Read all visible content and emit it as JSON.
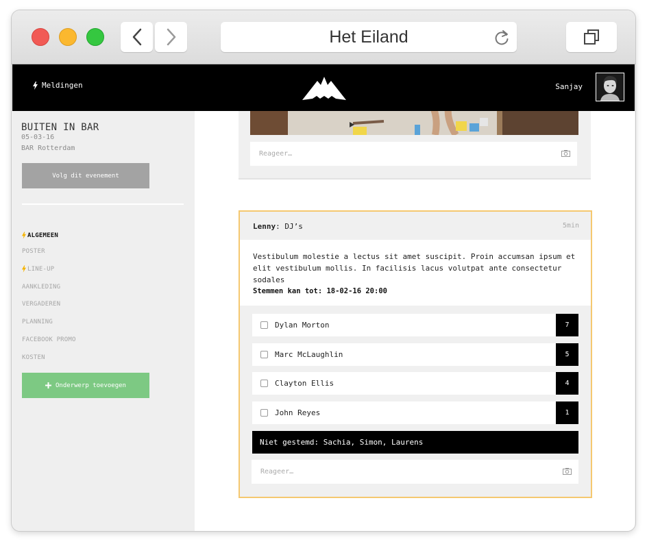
{
  "browser": {
    "title": "Het Eiland"
  },
  "topbar": {
    "notifications_label": "Meldingen",
    "username": "Sanjay"
  },
  "sidebar": {
    "event_title": "BUITEN IN BAR",
    "event_date": "05-03-16",
    "event_venue": "BAR Rotterdam",
    "follow_label": "Volg dit evenement",
    "menu": [
      {
        "label": "ALGEMEEN",
        "active": true,
        "flash": true
      },
      {
        "label": "POSTER",
        "active": false,
        "flash": false
      },
      {
        "label": "LINE-UP",
        "active": false,
        "flash": true
      },
      {
        "label": "AANKLEDING",
        "active": false,
        "flash": false
      },
      {
        "label": "VERGADEREN",
        "active": false,
        "flash": false
      },
      {
        "label": "PLANNING",
        "active": false,
        "flash": false
      },
      {
        "label": "FACEBOOK PROMO",
        "active": false,
        "flash": false
      },
      {
        "label": "KOSTEN",
        "active": false,
        "flash": false
      }
    ],
    "add_topic_label": "Onderwerp toevoegen"
  },
  "post1": {
    "reply_placeholder": "Reageer…"
  },
  "post2": {
    "author": "Lenny",
    "topic": ": DJ’s",
    "time": "5min",
    "body": "Vestibulum molestie a lectus sit amet suscipit. Proin accumsan ipsum et elit vestibulum mollis. In facilisis lacus volutpat ante consectetur sodales",
    "deadline": "Stemmen kan tot: 18-02-16 20:00",
    "poll": [
      {
        "name": "Dylan Morton",
        "votes": "7"
      },
      {
        "name": "Marc McLaughlin",
        "votes": "5"
      },
      {
        "name": "Clayton Ellis",
        "votes": "4"
      },
      {
        "name": "John Reyes",
        "votes": "1"
      }
    ],
    "not_voted": "Niet gestemd: Sachia, Simon, Laurens",
    "reply_placeholder": "Reageer…"
  },
  "colors": {
    "highlight_border": "#f5c86f",
    "add_button": "#7dc983",
    "flash": "#f5b400"
  },
  "icons": [
    "back-chevron-icon",
    "forward-chevron-icon",
    "reload-icon",
    "tabs-icon",
    "lightning-icon",
    "mountain-logo-icon",
    "camera-icon",
    "plus-icon"
  ]
}
